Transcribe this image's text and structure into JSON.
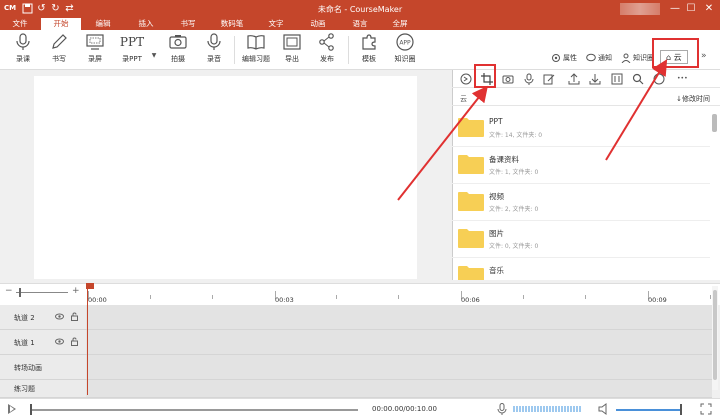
{
  "app": {
    "logo": "CM",
    "title": "未命名 - CourseMaker"
  },
  "menu": {
    "tabs": [
      "文件",
      "开始",
      "编辑",
      "插入",
      "书写",
      "数码笔",
      "文字",
      "动画",
      "语言",
      "全屏"
    ],
    "active": "开始"
  },
  "toolbar": {
    "tools": [
      "录课",
      "书写",
      "录屏",
      "录PPT",
      "拍摄",
      "录音",
      "编辑习题",
      "导出",
      "发布",
      "模板",
      "知识圈"
    ],
    "ppt_icon_text": "PPT",
    "app_icon_text": "APP",
    "right": {
      "properties": "属性",
      "notify": "通知",
      "knowledge": "知识圈",
      "cloud": "云",
      "more": "»"
    }
  },
  "panel": {
    "path": "云",
    "sort_label": "↓修改时间",
    "more_dots": "•••",
    "folders": [
      {
        "name": "PPT",
        "meta": "文件: 14, 文件夹: 0"
      },
      {
        "name": "备课资料",
        "meta": "文件: 1, 文件夹: 0"
      },
      {
        "name": "视频",
        "meta": "文件: 2, 文件夹: 0"
      },
      {
        "name": "图片",
        "meta": "文件: 0, 文件夹: 0"
      },
      {
        "name": "音乐",
        "meta": ""
      }
    ]
  },
  "timeline": {
    "zoom_minus": "−",
    "zoom_plus": "+",
    "ticks": [
      "00:00",
      "00:03",
      "00:06",
      "00:09"
    ],
    "tracks": [
      "轨道 2",
      "轨道 1",
      "转场动画",
      "练习题"
    ]
  },
  "player": {
    "time": "00:00.00/00:10.00"
  },
  "colors": {
    "brand": "#c5462b",
    "highlight": "#e03131",
    "folder": "#f7cf55"
  }
}
